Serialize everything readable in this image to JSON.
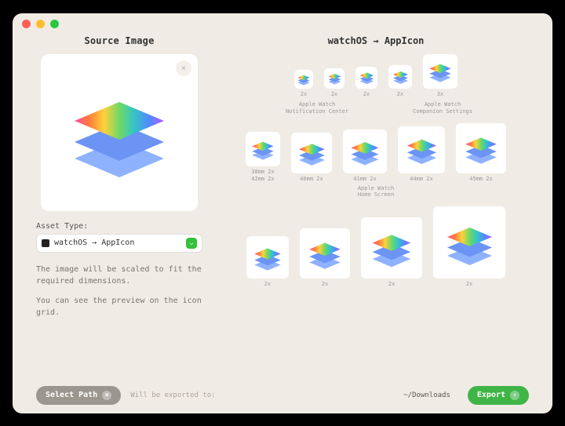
{
  "titlebar": {},
  "source": {
    "title": "Source Image",
    "clear_tooltip": "Clear"
  },
  "asset": {
    "label": "Asset Type:",
    "value": "watchOS → AppIcon"
  },
  "hints": {
    "line1": "The image will be scaled to fit the required dimensions.",
    "line2": "You can see the preview on the icon grid."
  },
  "grid": {
    "title": "watchOS → AppIcon",
    "group1": {
      "cells": [
        {
          "size": 24,
          "label": "2x"
        },
        {
          "size": 26,
          "label": "2x"
        },
        {
          "size": 28,
          "label": "2x"
        },
        {
          "size": 30,
          "label": "2x"
        },
        {
          "size": 44,
          "label": "3x"
        }
      ],
      "captions": [
        "Apple Watch\nNotification Center",
        "Apple Watch\nCompanion Settings"
      ]
    },
    "group2": {
      "cells": [
        {
          "size": 44,
          "label": "38mm 2x\n42mm 2x"
        },
        {
          "size": 52,
          "label": "40mm 2x"
        },
        {
          "size": 56,
          "label": "41mm 2x"
        },
        {
          "size": 60,
          "label": "44mm 2x"
        },
        {
          "size": 64,
          "label": "45mm 2x"
        }
      ],
      "caption": "Apple Watch\nHome Screen"
    },
    "group3": {
      "cells": [
        {
          "size": 54,
          "label": "2x"
        },
        {
          "size": 64,
          "label": "2x"
        },
        {
          "size": 78,
          "label": "2x"
        },
        {
          "size": 92,
          "label": "2x"
        }
      ]
    }
  },
  "footer": {
    "select_label": "Select Path",
    "hint": "Will be exported to:",
    "path": "~/Downloads",
    "export_label": "Export"
  },
  "icons": {
    "close": "×",
    "chevron": "⌵",
    "arrow": "›"
  }
}
